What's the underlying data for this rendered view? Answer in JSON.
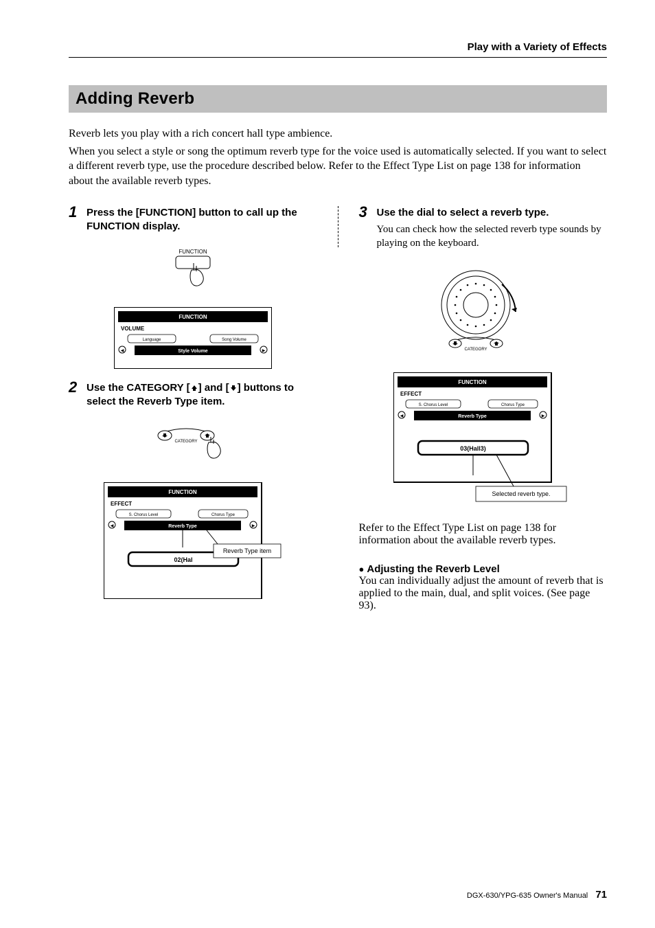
{
  "header": {
    "section_title": "Play with a Variety of Effects"
  },
  "section": {
    "heading": "Adding Reverb"
  },
  "intro": {
    "p1": "Reverb lets you play with a rich concert hall type ambience.",
    "p2": "When you select a style or song the optimum reverb type for the voice used is automatically selected. If you want to select a different reverb type, use the procedure described below. Refer to the Effect Type List on page 138 for information about the available reverb types."
  },
  "steps": {
    "s1": {
      "num": "1",
      "title": "Press the [FUNCTION] button to call up the FUNCTION display.",
      "fig1": {
        "button_label": "FUNCTION",
        "lcd_title": "FUNCTION",
        "lcd_section": "VOLUME",
        "lcd_left": "Language",
        "lcd_right": "Song Volume",
        "lcd_center": "Style Volume"
      }
    },
    "s2": {
      "num": "2",
      "title_a": "Use the CATEGORY [",
      "title_b": "] and [",
      "title_c": "] buttons to select the Reverb Type item.",
      "fig1": {
        "label": "CATEGORY",
        "lcd_title": "FUNCTION",
        "lcd_section": "EFFECT",
        "lcd_left": "S. Chorus Level",
        "lcd_right": "Chorus Type",
        "lcd_center": "Reverb Type",
        "lcd_value": "02(Hal",
        "callout": "Reverb Type item"
      }
    },
    "s3": {
      "num": "3",
      "title": "Use the dial to select a reverb type.",
      "body": "You can check how the selected reverb type sounds by playing on the keyboard.",
      "fig1": {
        "label": "CATEGORY",
        "lcd_title": "FUNCTION",
        "lcd_section": "EFFECT",
        "lcd_left": "S. Chorus Level",
        "lcd_right": "Chorus Type",
        "lcd_center": "Reverb Type",
        "lcd_value": "03(Hall3)",
        "callout": "Selected reverb type."
      },
      "after": "Refer to the Effect Type List on page 138 for information about the available reverb types."
    }
  },
  "subsection": {
    "head": "Adjusting the Reverb Level",
    "body": "You can individually adjust the amount of reverb that is applied to the main, dual, and split voices. (See page 93)."
  },
  "footer": {
    "text": "DGX-630/YPG-635  Owner's Manual",
    "page": "71"
  }
}
